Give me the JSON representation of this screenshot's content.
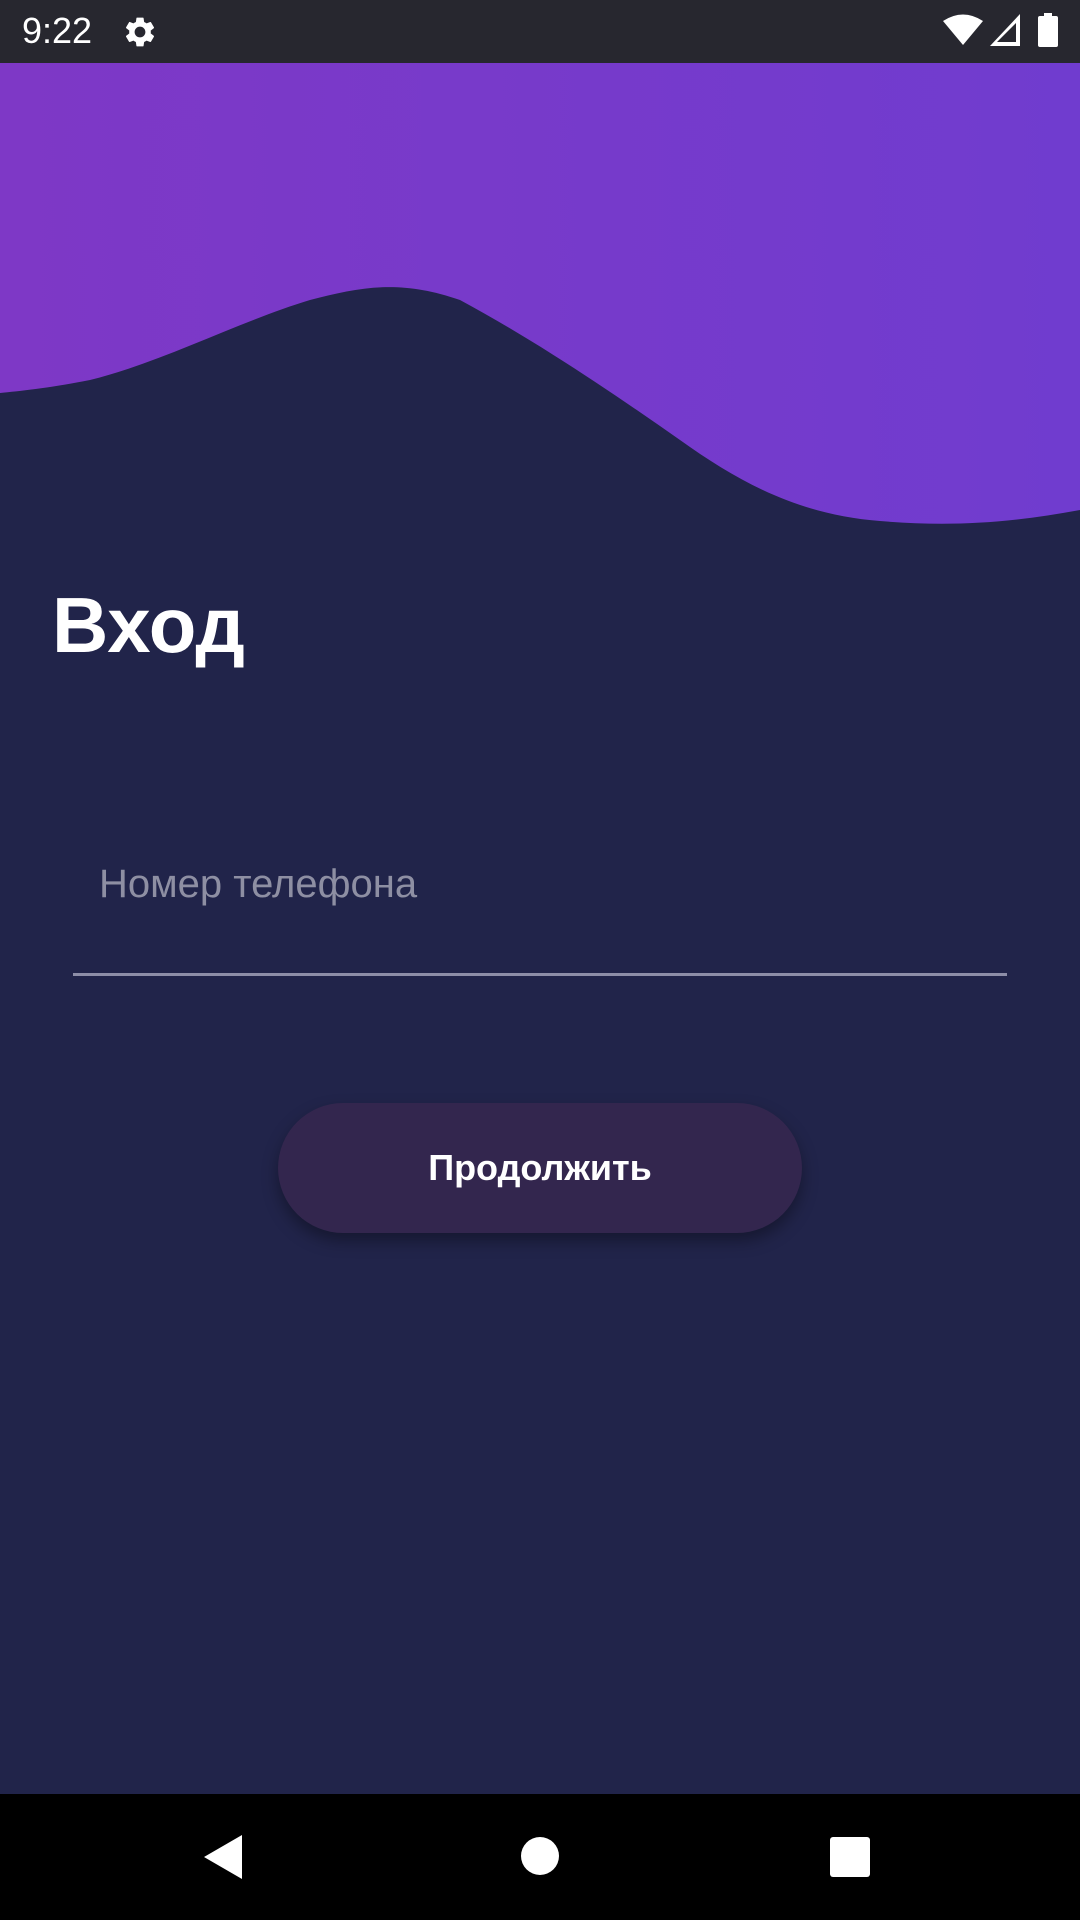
{
  "status_bar": {
    "time": "9:22",
    "icons": [
      "gear-icon",
      "wifi-icon",
      "signal-icon",
      "battery-icon"
    ]
  },
  "login": {
    "title": "Вход",
    "phone_placeholder": "Номер телефона",
    "phone_value": "",
    "continue_label": "Продолжить"
  },
  "nav_bar": {
    "icons": [
      "back-icon",
      "home-icon",
      "recent-apps-icon"
    ]
  },
  "colors": {
    "background": "#21244a",
    "wave_gradient_start": "#7e38c6",
    "wave_gradient_end": "#703ccf",
    "button": "#33264e",
    "status_bar": "#27272f",
    "nav_bar": "#000000"
  }
}
